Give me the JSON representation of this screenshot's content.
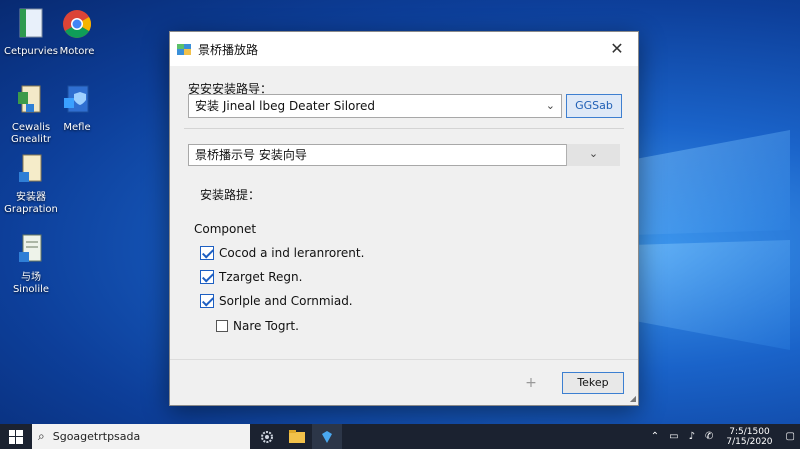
{
  "desktop": {
    "icons": [
      {
        "label": "Cetpurvies"
      },
      {
        "label": "Motore"
      },
      {
        "label": "Cewalis",
        "label2": "Gnealitr"
      },
      {
        "label": "Mefle"
      },
      {
        "label": "安装器",
        "label2": "Grapration"
      },
      {
        "label": "与场",
        "label2": "Sinolile"
      }
    ]
  },
  "dialog": {
    "title": "景桥播放路",
    "close_glyph": "✕",
    "section1_label": "安安安装路导：",
    "combo1_value": "安装 Jineal lbeg Deater Silored",
    "combo1_button": "GGSab",
    "combo2_value": "景桥播示号 安装向导",
    "path_label": "安装路提：",
    "components_label": "Componet",
    "components": [
      {
        "label": "Cocod a ind leranrorent.",
        "checked": true
      },
      {
        "label": "Tzarget Regn.",
        "checked": true
      },
      {
        "label": "Sorlple and Cornmiad.",
        "checked": true
      },
      {
        "label": "Nare Togrt.",
        "checked": false
      }
    ],
    "plus_button": "+",
    "ok_button": "Tekep"
  },
  "taskbar": {
    "search_text": "Sgoagetrtpsada",
    "time": "7:5/1500",
    "date": "7/15/2020"
  },
  "colors": {
    "accent": "#1d5fc2",
    "taskbar": "#1b2230",
    "dialog_bg": "#f0f0f0"
  }
}
